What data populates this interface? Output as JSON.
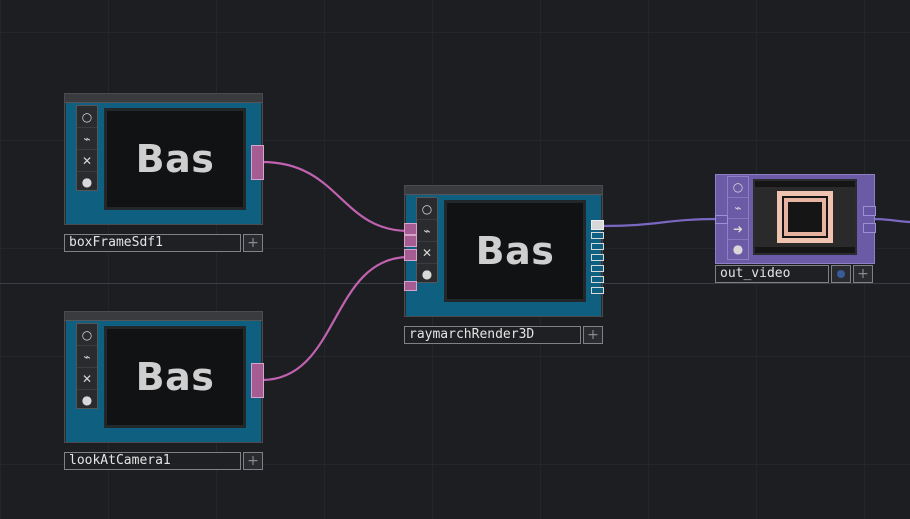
{
  "nodes": {
    "boxFrameSdf1": {
      "name": "boxFrameSdf1",
      "preview_text": "Bas"
    },
    "lookAtCamera1": {
      "name": "lookAtCamera1",
      "preview_text": "Bas"
    },
    "raymarchRender3D": {
      "name": "raymarchRender3D",
      "preview_text": "Bas"
    },
    "out_video": {
      "name": "out_video"
    }
  },
  "flags": {
    "viewer": "○",
    "bypass": "⌁",
    "delete": "✕",
    "lock": "●"
  },
  "plus_glyph": "+",
  "colors": {
    "background": "#1c1e22",
    "pop_node": "#0f5f80",
    "top_node": "#6b5aa6",
    "pop_wire": "#c062b0",
    "top_wire": "#7a68c0"
  }
}
